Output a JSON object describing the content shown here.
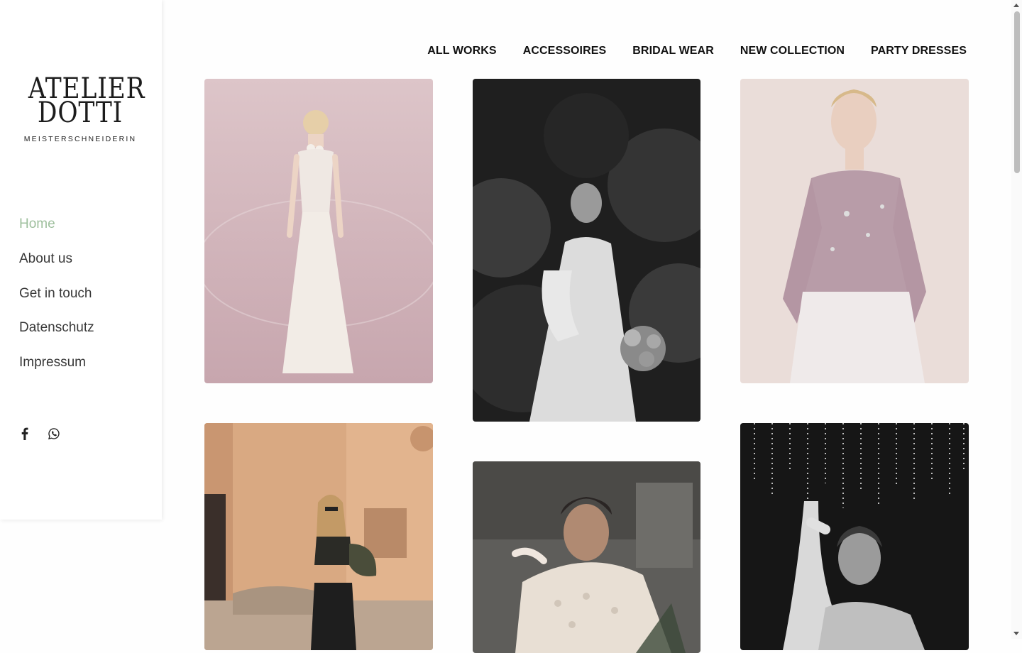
{
  "sidebar": {
    "logo": {
      "line1": "ATELIER",
      "line2": "DOTTI",
      "tagline": "MEISTERSCHNEIDERIN"
    },
    "nav": [
      {
        "label": "Home",
        "active": true
      },
      {
        "label": "About us",
        "active": false
      },
      {
        "label": "Get in touch",
        "active": false
      },
      {
        "label": "Datenschutz",
        "active": false
      },
      {
        "label": "Impressum",
        "active": false
      }
    ],
    "social": [
      {
        "icon": "facebook-icon"
      },
      {
        "icon": "whatsapp-icon"
      }
    ]
  },
  "filters": [
    "ALL WORKS",
    "ACCESSOIRES",
    "BRIDAL WEAR",
    "NEW COLLECTION",
    "PARTY DRESSES"
  ],
  "gallery": [
    {
      "subject": "woman in white strapless gown with pearl necklace",
      "palette": "pink"
    },
    {
      "subject": "bride in white gown holding bouquet, black and white",
      "palette": "mono-dark"
    },
    {
      "subject": "woman in embellished lilac top and white skirt",
      "palette": "pink"
    },
    {
      "subject": "woman in black outfit in front of building",
      "palette": "warm"
    },
    {
      "subject": "woman in sequined white jacket",
      "palette": "grey"
    },
    {
      "subject": "woman under hanging lights, black and white",
      "palette": "mono-dark"
    }
  ],
  "colors": {
    "accent": "#9ebf9d",
    "text": "#383838"
  }
}
